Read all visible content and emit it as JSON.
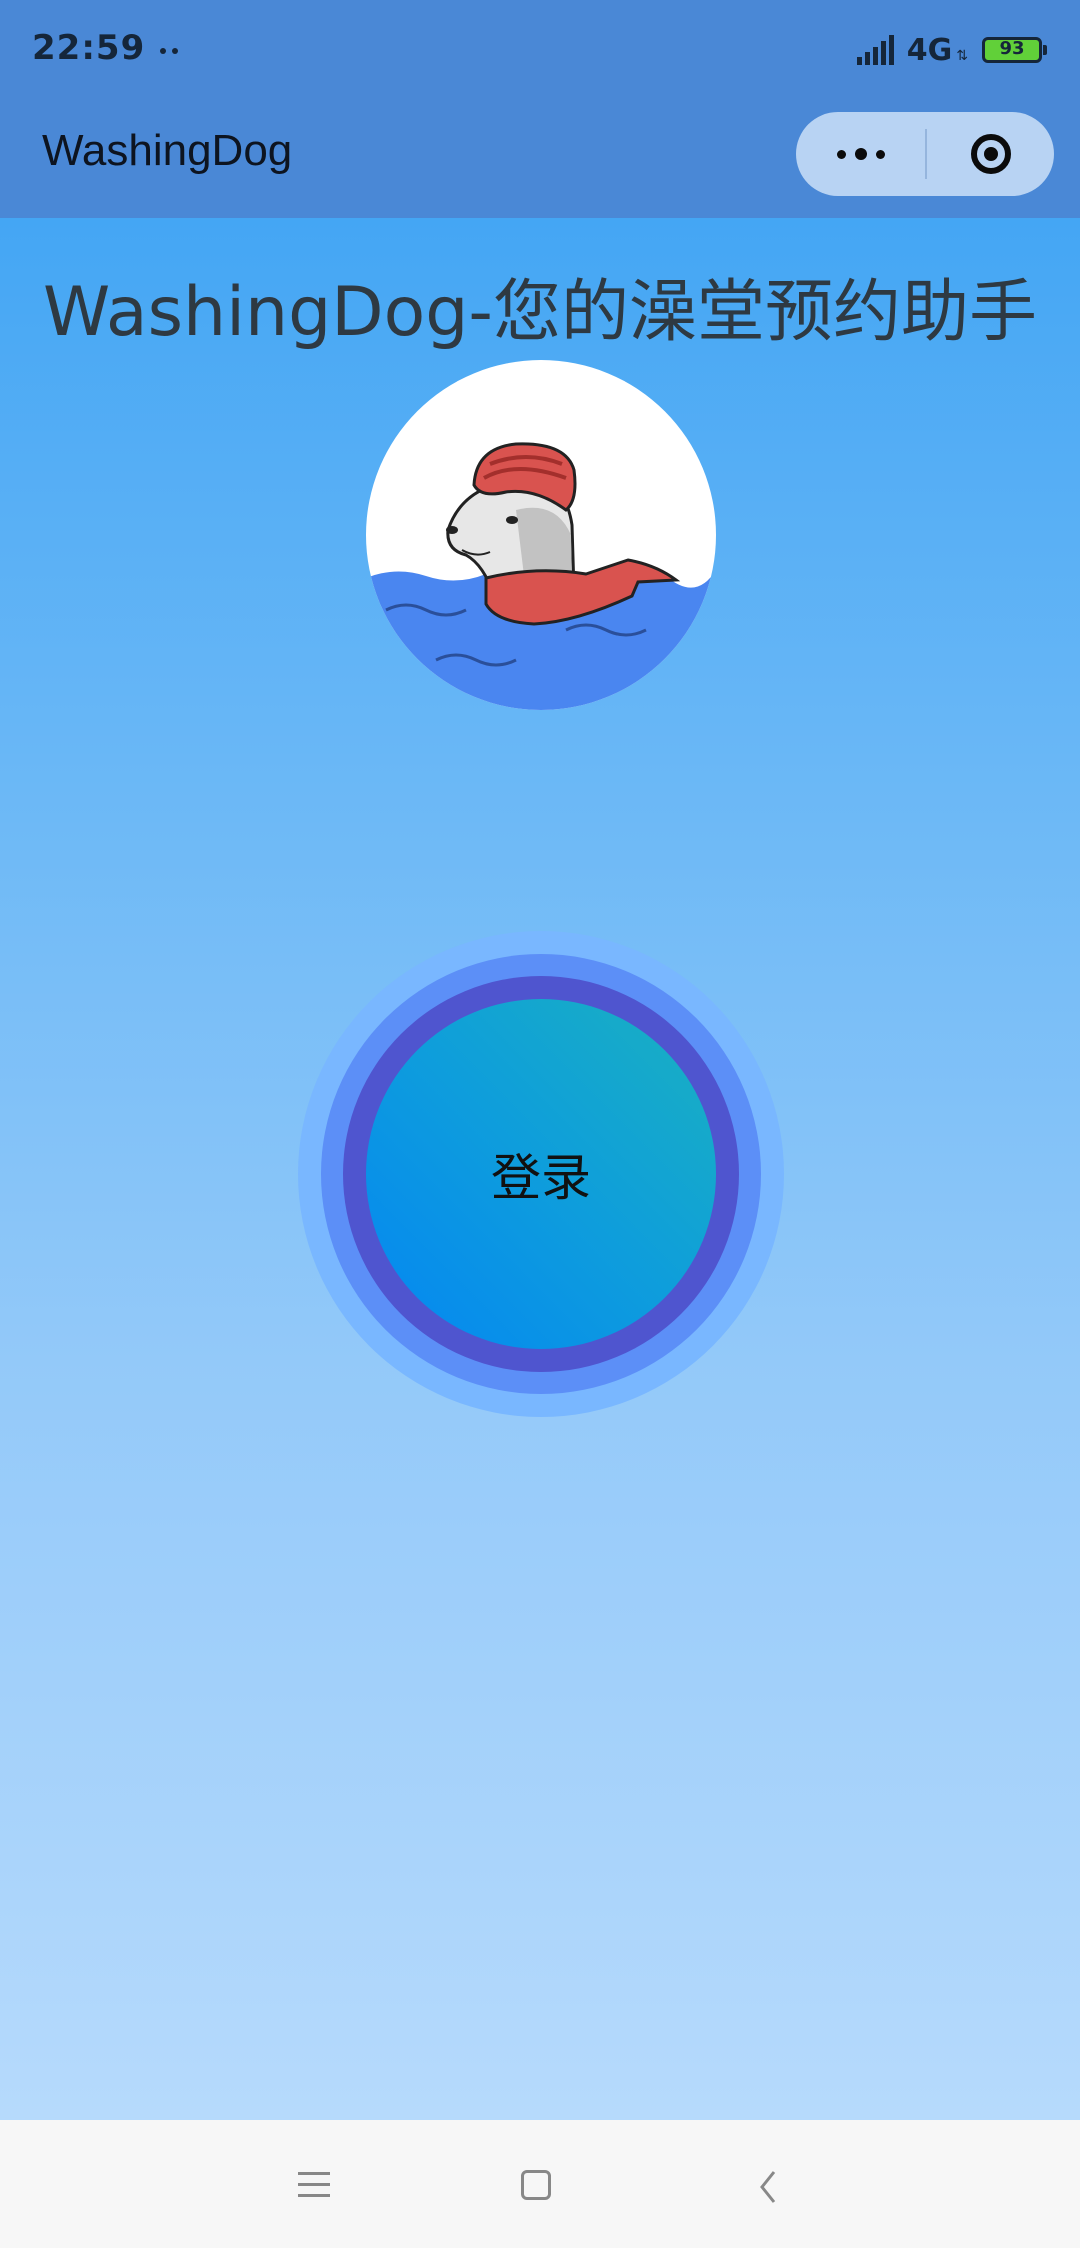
{
  "status_bar": {
    "time": "22:59",
    "network": "4G",
    "battery": "93",
    "icons": [
      "signal-icon",
      "data-arrows-icon",
      "battery-icon"
    ]
  },
  "nav_bar": {
    "title": "WashingDog",
    "more_icon": "more-dots-icon",
    "close_icon": "target-close-icon"
  },
  "main": {
    "headline": "WashingDog-您的澡堂预约助手",
    "avatar_icon": "dog-in-water-avatar",
    "login_label": "登录"
  },
  "colors": {
    "nav_bar_bg": "#4a88d6",
    "gradient_top": "#44a6f4",
    "gradient_bottom": "#b6dafc",
    "login_ring_outer": "#79b7ff",
    "login_ring_mid": "#5c8ff7",
    "login_ring_inner": "#4f55cf",
    "login_fill_start": "#1ab1c0",
    "login_fill_end": "#0486f3"
  },
  "system_nav": {
    "icons": [
      "menu-icon",
      "home-icon",
      "back-icon"
    ]
  }
}
